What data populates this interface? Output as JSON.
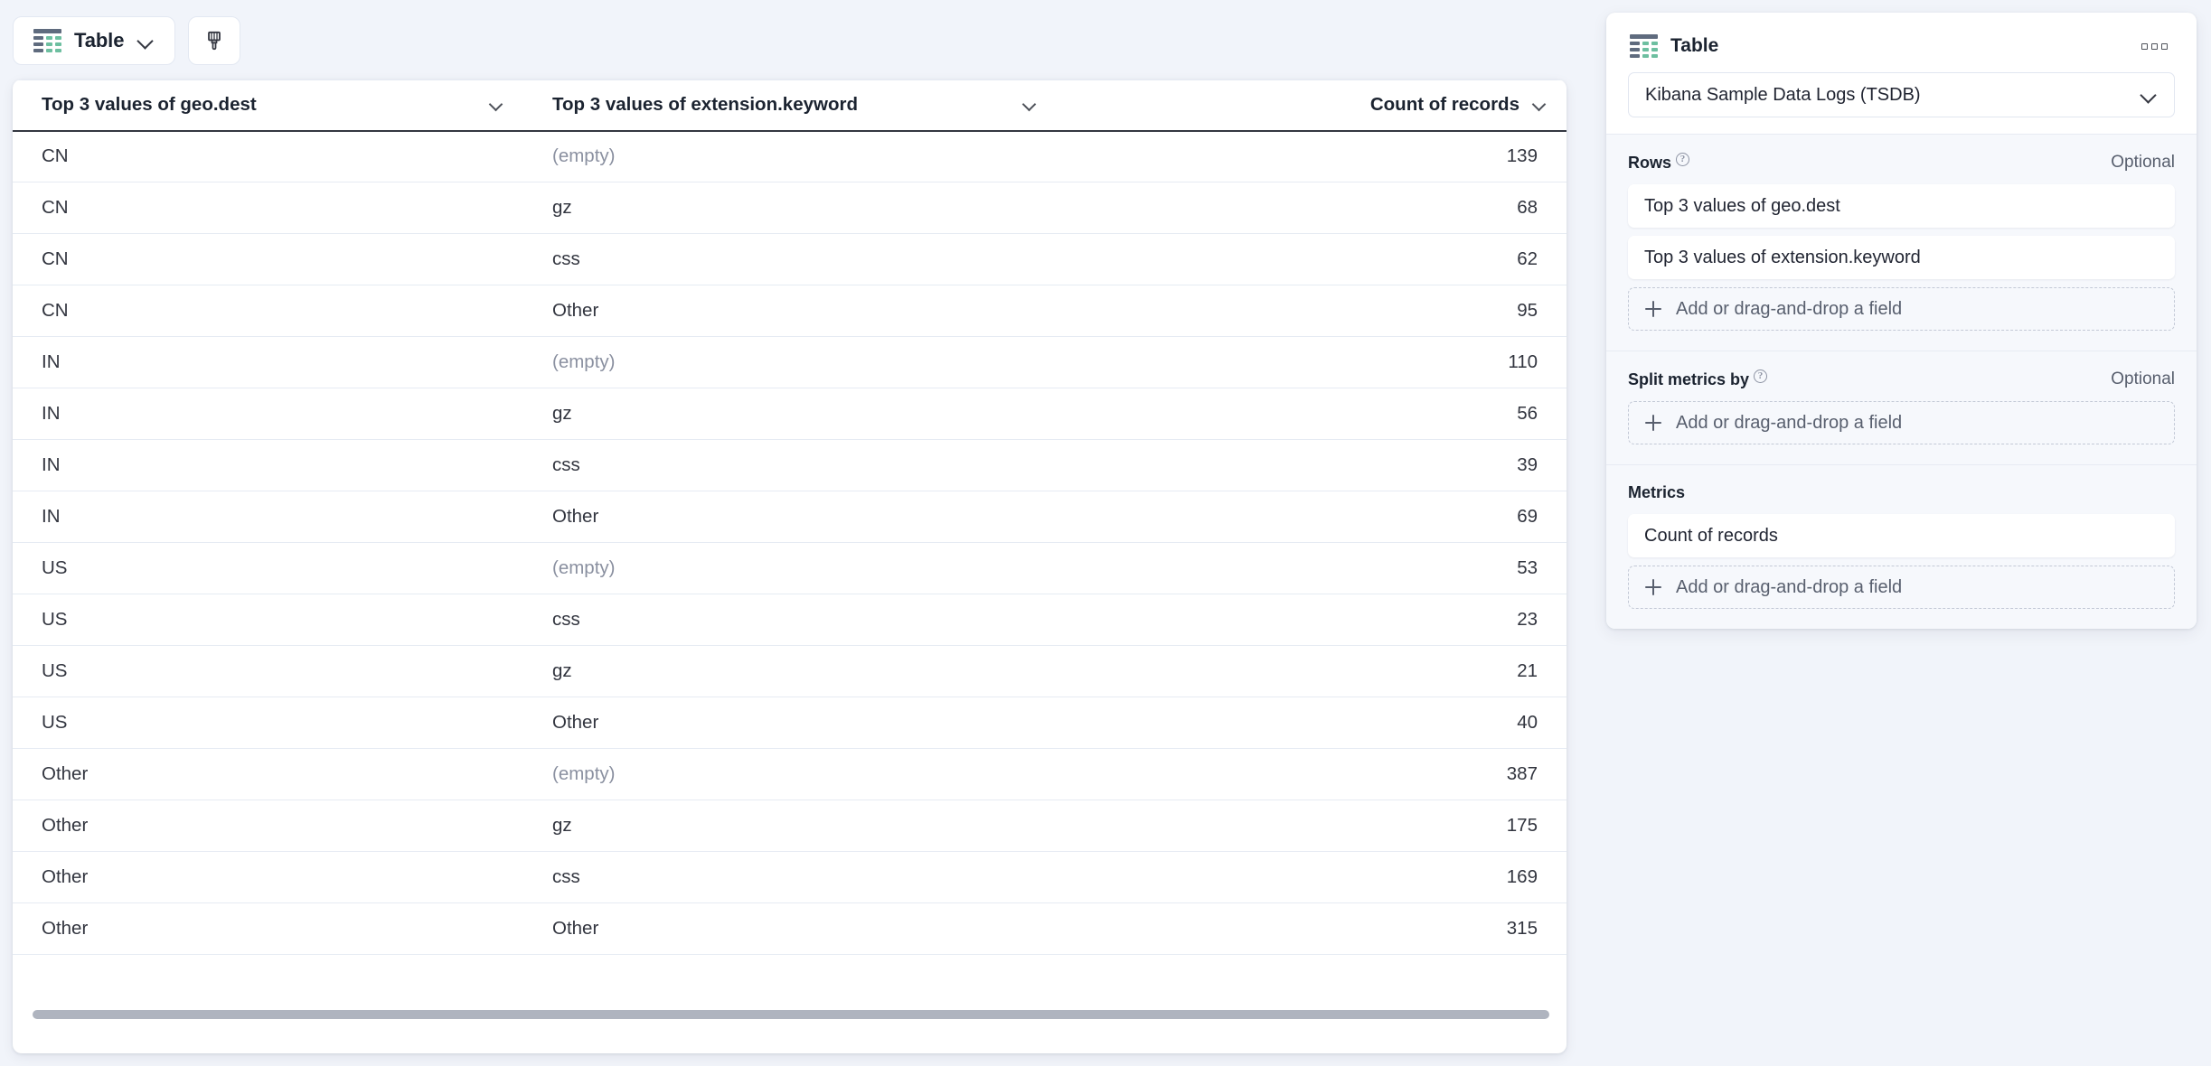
{
  "toolbar": {
    "chart_switch": {
      "label": "Table",
      "icon": "table-icon",
      "chevron": "chevron-down-icon"
    },
    "style_button": {
      "icon": "paintbrush-icon",
      "title": "Visual options"
    }
  },
  "table": {
    "columns": [
      {
        "label": "Top 3 values of geo.dest",
        "align": "left",
        "menu_icon": "chevron-down-icon"
      },
      {
        "label": "Top 3 values of extension.keyword",
        "align": "left",
        "menu_icon": "chevron-down-icon"
      },
      {
        "label": "Count of records",
        "align": "right",
        "menu_icon": "chevron-down-icon"
      }
    ],
    "rows": [
      {
        "geo": "CN",
        "ext": "(empty)",
        "count": "139",
        "ext_empty": true
      },
      {
        "geo": "CN",
        "ext": "gz",
        "count": "68",
        "ext_empty": false
      },
      {
        "geo": "CN",
        "ext": "css",
        "count": "62",
        "ext_empty": false
      },
      {
        "geo": "CN",
        "ext": "Other",
        "count": "95",
        "ext_empty": false
      },
      {
        "geo": "IN",
        "ext": "(empty)",
        "count": "110",
        "ext_empty": true
      },
      {
        "geo": "IN",
        "ext": "gz",
        "count": "56",
        "ext_empty": false
      },
      {
        "geo": "IN",
        "ext": "css",
        "count": "39",
        "ext_empty": false
      },
      {
        "geo": "IN",
        "ext": "Other",
        "count": "69",
        "ext_empty": false
      },
      {
        "geo": "US",
        "ext": "(empty)",
        "count": "53",
        "ext_empty": true
      },
      {
        "geo": "US",
        "ext": "css",
        "count": "23",
        "ext_empty": false
      },
      {
        "geo": "US",
        "ext": "gz",
        "count": "21",
        "ext_empty": false
      },
      {
        "geo": "US",
        "ext": "Other",
        "count": "40",
        "ext_empty": false
      },
      {
        "geo": "Other",
        "ext": "(empty)",
        "count": "387",
        "ext_empty": true
      },
      {
        "geo": "Other",
        "ext": "gz",
        "count": "175",
        "ext_empty": false
      },
      {
        "geo": "Other",
        "ext": "css",
        "count": "169",
        "ext_empty": false
      },
      {
        "geo": "Other",
        "ext": "Other",
        "count": "315",
        "ext_empty": false
      }
    ]
  },
  "config_panel": {
    "title": "Table",
    "title_icon": "table-icon",
    "more_actions_icon": "boxes-horizontal-icon",
    "data_source": {
      "label": "Kibana Sample Data Logs (TSDB)",
      "chevron": "chevron-down-icon"
    },
    "sections": [
      {
        "title": "Rows",
        "has_help": true,
        "optional_label": "Optional",
        "fields": [
          "Top 3 values of geo.dest",
          "Top 3 values of extension.keyword"
        ],
        "add_label": "Add or drag-and-drop a field"
      },
      {
        "title": "Split metrics by",
        "has_help": true,
        "optional_label": "Optional",
        "fields": [],
        "add_label": "Add or drag-and-drop a field"
      },
      {
        "title": "Metrics",
        "has_help": false,
        "optional_label": "",
        "fields": [
          "Count of records"
        ],
        "add_label": "Add or drag-and-drop a field"
      }
    ]
  },
  "colors": {
    "page_background": "#f1f4fa",
    "card_background": "#ffffff",
    "section_background": "#f6f8fc",
    "text_primary": "#1b2330",
    "text_muted": "#8a90a0",
    "header_rule": "#343741",
    "row_rule": "#e6ebf3",
    "accent_green": "#6dbfa0",
    "scrollbar": "#afb4bf"
  }
}
